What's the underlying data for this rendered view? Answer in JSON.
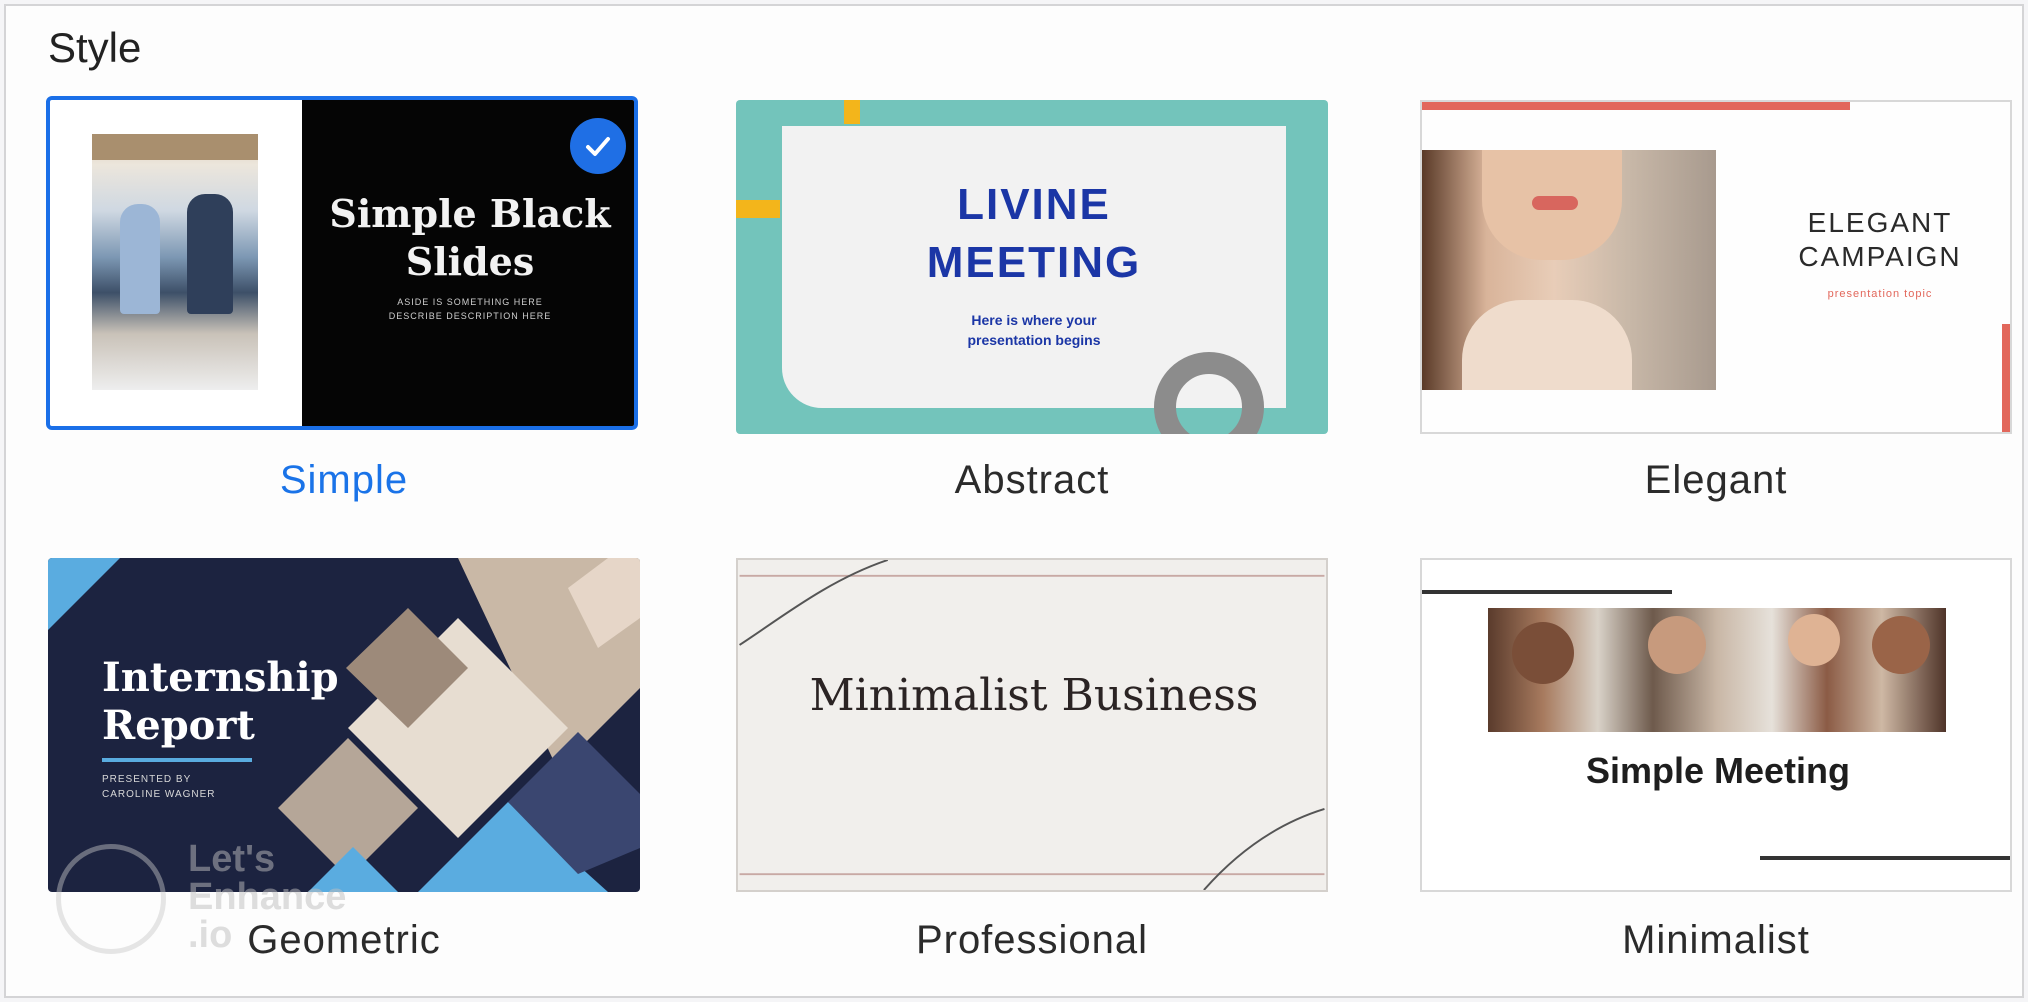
{
  "section": {
    "title": "Style"
  },
  "styles": [
    {
      "caption": "Simple",
      "selected": true,
      "thumb_title_1": "Simple Black",
      "thumb_title_2": "Slides",
      "thumb_sub_1": "ASIDE IS SOMETHING HERE",
      "thumb_sub_2": "DESCRIBE DESCRIPTION HERE"
    },
    {
      "caption": "Abstract",
      "selected": false,
      "thumb_title_1": "LIVINE",
      "thumb_title_2": "MEETING",
      "thumb_sub_1": "Here is where your",
      "thumb_sub_2": "presentation begins"
    },
    {
      "caption": "Elegant",
      "selected": false,
      "thumb_title_1": "ELEGANT",
      "thumb_title_2": "CAMPAIGN",
      "thumb_sub_1": "presentation topic"
    },
    {
      "caption": "Geometric",
      "selected": false,
      "thumb_title_1": "Internship",
      "thumb_title_2": "Report",
      "thumb_sub_1": "PRESENTED BY",
      "thumb_sub_2": "CAROLINE WAGNER"
    },
    {
      "caption": "Professional",
      "selected": false,
      "thumb_title_1": "Minimalist Business"
    },
    {
      "caption": "Minimalist",
      "selected": false,
      "thumb_title_1": "Simple Meeting"
    }
  ],
  "watermark": {
    "line1": "Let's",
    "line2": "Enhance",
    "line3": ".io"
  },
  "colors": {
    "accent": "#1a73e8",
    "teal": "#73c4bb",
    "navy": "#1c2340",
    "coral": "#e2675b",
    "royal_blue": "#1b36a6"
  },
  "icons": {
    "selected": "checkmark-icon"
  }
}
